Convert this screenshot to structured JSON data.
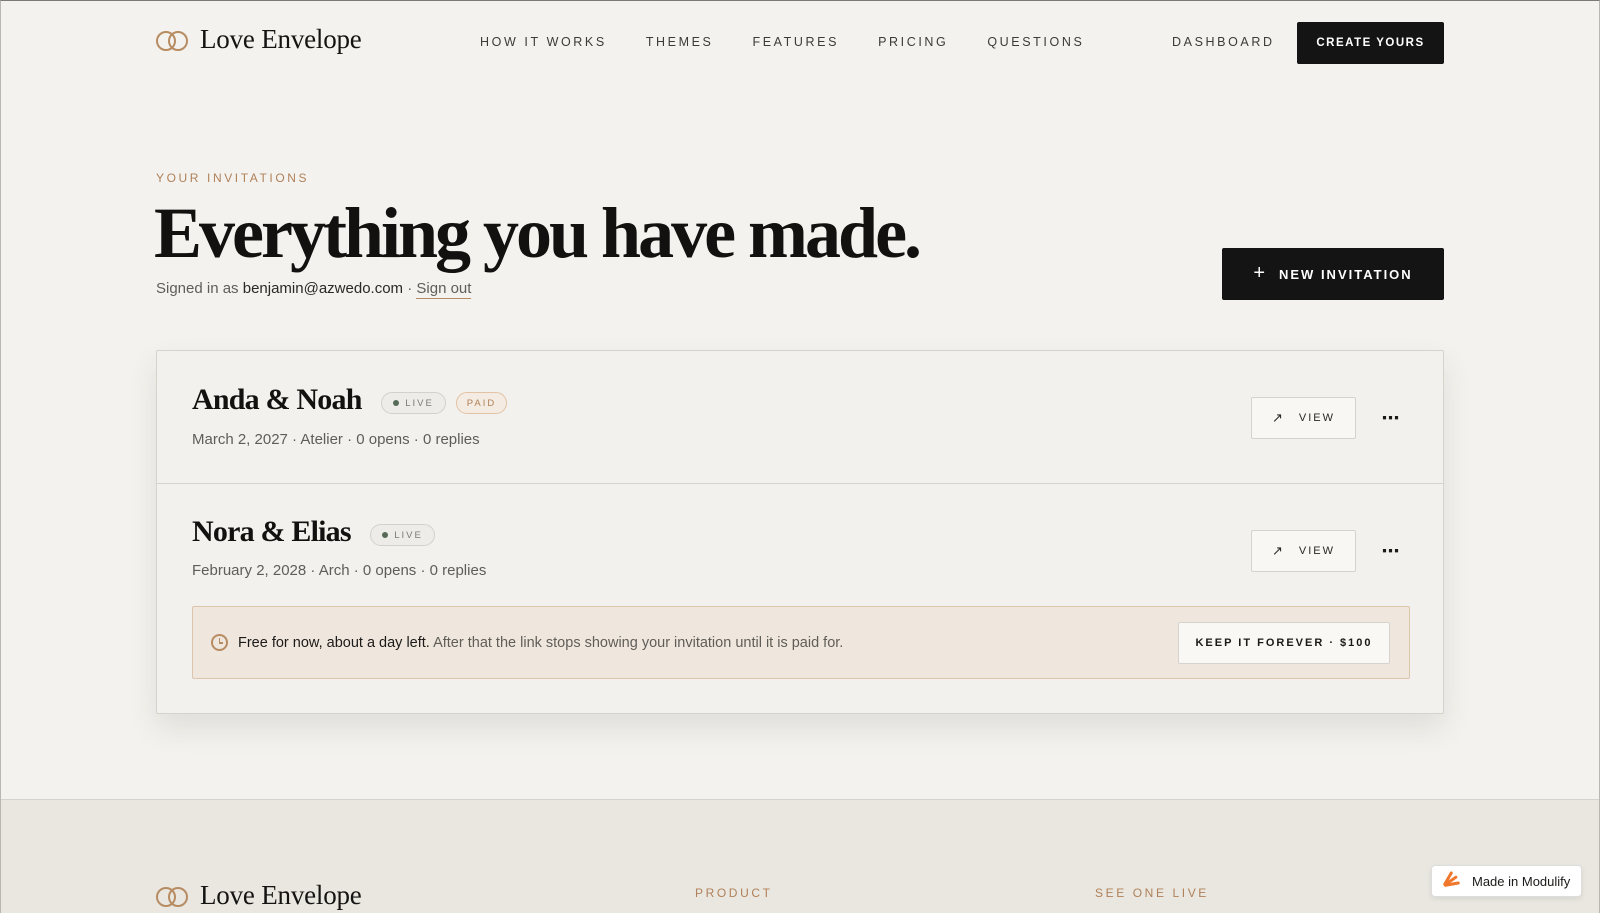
{
  "header": {
    "brand": "Love Envelope",
    "nav": [
      "HOW IT WORKS",
      "THEMES",
      "FEATURES",
      "PRICING",
      "QUESTIONS"
    ],
    "dashboard": "DASHBOARD",
    "create": "CREATE YOURS"
  },
  "hero": {
    "eyebrow": "YOUR INVITATIONS",
    "title": "Everything you have made.",
    "signed_prefix": "Signed in as",
    "email": "benjamin@azwedo.com",
    "separator": "·",
    "signout": "Sign out",
    "new_invitation": "NEW INVITATION"
  },
  "invitations": [
    {
      "couple": "Anda & Noah",
      "badges": [
        "LIVE",
        "PAID"
      ],
      "meta": "March 2, 2027 · Atelier · 0 opens · 0 replies",
      "view": "VIEW"
    },
    {
      "couple": "Nora & Elias",
      "badges": [
        "LIVE"
      ],
      "meta": "February 2, 2028 · Arch · 0 opens · 0 replies",
      "view": "VIEW",
      "notice": {
        "strong": "Free for now, about a day left.",
        "text": " After that the link stops showing your invitation until it is paid for.",
        "action": "KEEP IT FOREVER · $100"
      }
    }
  ],
  "footer": {
    "brand": "Love Envelope",
    "columns": [
      "PRODUCT",
      "SEE ONE LIVE"
    ]
  },
  "badge_widget": "Made in Modulify",
  "colors": {
    "accent": "#b0815a",
    "dark": "#141414",
    "background": "#f3f2ee",
    "live_dot": "#556b57"
  }
}
